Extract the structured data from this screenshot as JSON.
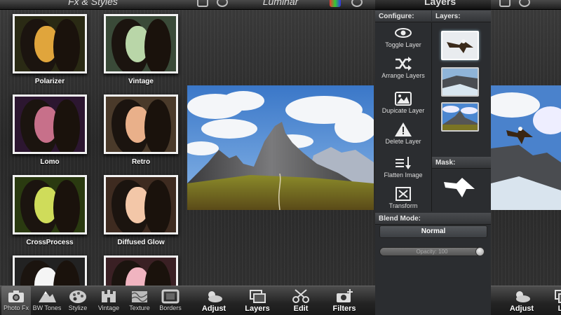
{
  "fx_panel": {
    "title": "Fx & Styles",
    "effects": [
      {
        "label": "Polarizer",
        "tone": "#e0a53c",
        "bg": "#2a2a14"
      },
      {
        "label": "Vintage",
        "tone": "#b9d6a8",
        "bg": "#3a4a38"
      },
      {
        "label": "Lomo",
        "tone": "#c7708a",
        "bg": "#2c1630"
      },
      {
        "label": "Retro",
        "tone": "#e9b08a",
        "bg": "#4a3a2a"
      },
      {
        "label": "CrossProcess",
        "tone": "#cfdc5a",
        "bg": "#2a3a10"
      },
      {
        "label": "Diffused Glow",
        "tone": "#f3c7a8",
        "bg": "#3e2b20"
      },
      {
        "label": "",
        "tone": "#f5f5f5",
        "bg": "#222"
      },
      {
        "label": "",
        "tone": "#f0b4c0",
        "bg": "#3a2024"
      }
    ],
    "toolbar": [
      {
        "label": "Photo Fx",
        "icon": "camera-icon",
        "active": true
      },
      {
        "label": "BW Tones",
        "icon": "mountain-icon",
        "active": false
      },
      {
        "label": "Stylize",
        "icon": "palette-icon",
        "active": false
      },
      {
        "label": "Vintage",
        "icon": "castle-icon",
        "active": false
      },
      {
        "label": "Texture",
        "icon": "texture-icon",
        "active": false
      },
      {
        "label": "Borders",
        "icon": "frame-icon",
        "active": false
      }
    ]
  },
  "main": {
    "app_title": "Luminar",
    "toolbar": [
      {
        "label": "Adjust",
        "icon": "sun-cloud-icon"
      },
      {
        "label": "Layers",
        "icon": "layers-icon"
      },
      {
        "label": "Edit",
        "icon": "scissors-icon"
      },
      {
        "label": "Filters",
        "icon": "camera-plus-icon"
      }
    ]
  },
  "layers_panel": {
    "title": "Layers",
    "configure_header": "Configure:",
    "layers_header": "Layers:",
    "mask_header": "Mask:",
    "blend_header": "Blend Mode:",
    "blend_value": "Normal",
    "opacity_label": "Opacity: 100",
    "opacity": 100,
    "configure_items": [
      {
        "label": "Toggle Layer",
        "icon": "eye-icon"
      },
      {
        "label": "Arrange Layers",
        "icon": "shuffle-icon"
      },
      {
        "label": "Dupicate Layer",
        "icon": "image-icon"
      },
      {
        "label": "Delete Layer",
        "icon": "warning-icon"
      },
      {
        "label": "Flatten Image",
        "icon": "flatten-icon"
      },
      {
        "label": "Transform",
        "icon": "transform-icon"
      }
    ]
  },
  "right_panel": {
    "toolbar": [
      {
        "label": "Adjust",
        "icon": "sun-cloud-icon"
      },
      {
        "label": "La",
        "icon": "layers-icon"
      }
    ]
  }
}
